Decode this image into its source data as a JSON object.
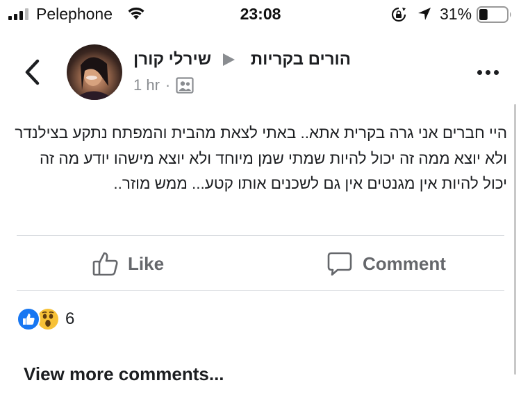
{
  "status_bar": {
    "carrier": "Pelephone",
    "time": "23:08",
    "battery_percent": "31%",
    "battery_level": 0.31
  },
  "post": {
    "group": "הורים בקריות",
    "author": "שירלי קורן",
    "time": "1 hr",
    "meta_separator": "·",
    "audience_icon": "group-audience-icon",
    "text": "היי חברים אני גרה בקרית אתא.. באתי לצאת מהבית והמפתח נתקע בצילנדר ולא יוצא ממה זה יכול להיות שמתי שמן מיוחד ולא יוצא מישהו יודע מה זה יכול להיות אין מגנטים אין גם לשכנים אותו קטע... ממש מוזר.."
  },
  "actions": {
    "like_label": "Like",
    "comment_label": "Comment"
  },
  "reactions": {
    "types": [
      "like",
      "wow"
    ],
    "count": "6"
  },
  "comments": {
    "view_more_label": "View more comments..."
  },
  "colors": {
    "like_blue": "#1877f2",
    "wow_yellow": "#f7c137",
    "secondary_text": "#65676b"
  }
}
